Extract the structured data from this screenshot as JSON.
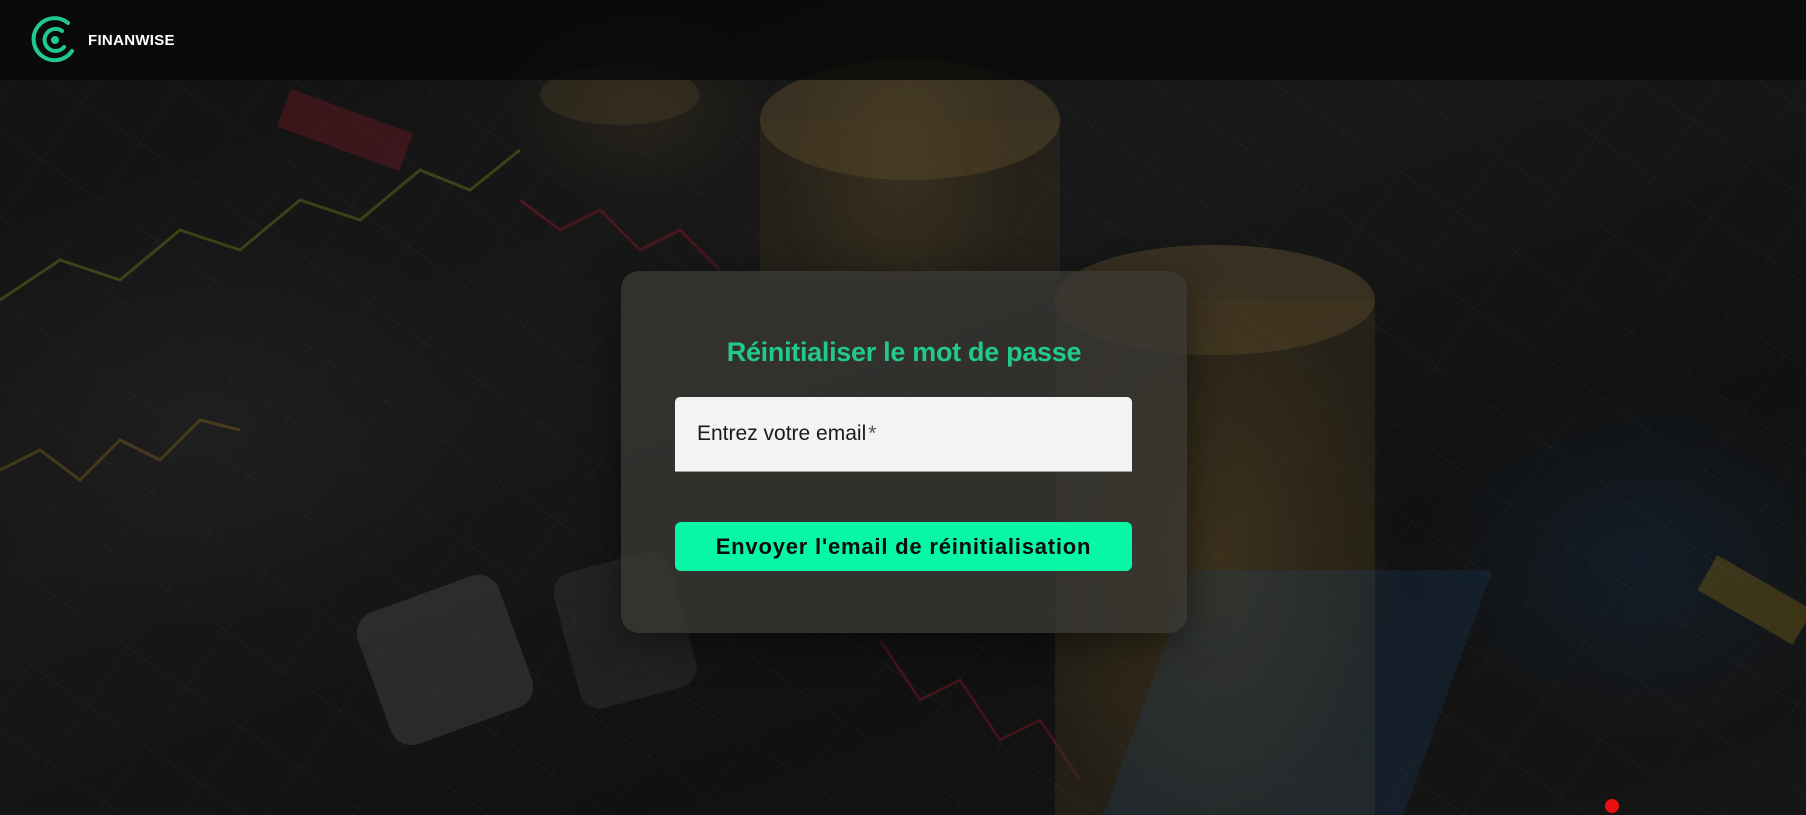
{
  "brand": {
    "name": "FINANWISE",
    "logo_icon": "finanwise-logo-icon",
    "logo_color": "#22c98d"
  },
  "reset_form": {
    "title": "Réinitialiser le mot de passe",
    "email_label": "Entrez votre email",
    "required_marker": "*",
    "submit_label": "Envoyer l'email de réinitialisation"
  },
  "colors": {
    "accent": "#22c98d",
    "button": "#07f7a6",
    "recording_dot": "#e81010"
  }
}
